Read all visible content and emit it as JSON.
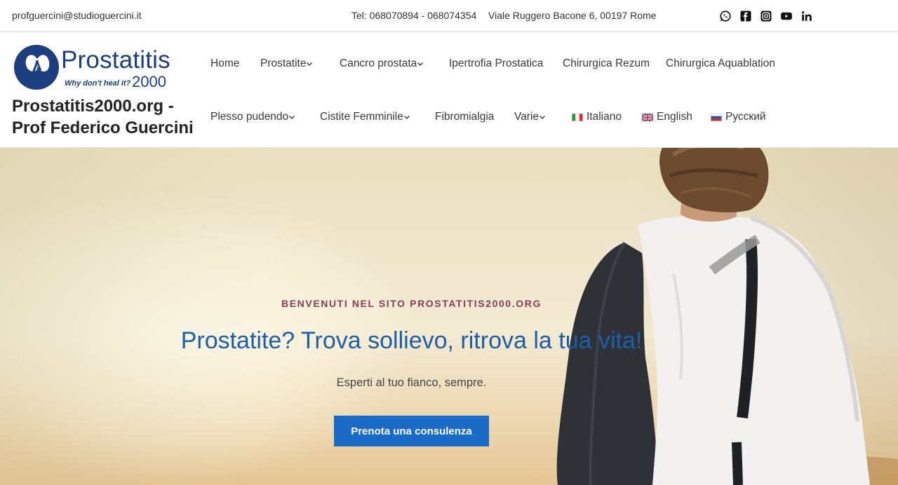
{
  "topbar": {
    "email": "profguercini@studioguercini.it",
    "phone": "Tel: 068070894 - 068074354",
    "address": "Viale Ruggero Bacone 6, 00197 Rome",
    "social": [
      "whatsapp-icon",
      "facebook-icon",
      "instagram-icon",
      "youtube-icon",
      "linkedin-icon"
    ]
  },
  "logo": {
    "brand": "Prostatitis",
    "tagline": "Why don't heal it?",
    "year": "2000"
  },
  "site_title_line1": "Prostatitis2000.org -",
  "site_title_line2": "Prof Federico Guercini",
  "nav": {
    "row1": [
      {
        "label": "Home",
        "active": true,
        "dropdown": false
      },
      {
        "label": "Prostatite",
        "dropdown": true
      },
      {
        "label": "Cancro prostata",
        "dropdown": true
      },
      {
        "label": "Ipertrofia Prostatica",
        "dropdown": false
      },
      {
        "label": "Chirurgica Rezum",
        "dropdown": false
      },
      {
        "label": "Chirurgica Aquablation",
        "dropdown": false
      }
    ],
    "row2": [
      {
        "label": "Plesso pudendo",
        "dropdown": true
      },
      {
        "label": "Cistite Femminile",
        "dropdown": true
      },
      {
        "label": "Fibromialgia",
        "dropdown": false
      },
      {
        "label": "Varie",
        "dropdown": true
      },
      {
        "label": "Italiano",
        "flag": "italy-flag-icon"
      },
      {
        "label": "English",
        "flag": "uk-flag-icon"
      },
      {
        "label": "Русский",
        "flag": "russia-flag-icon"
      }
    ]
  },
  "hero": {
    "eyebrow": "BENVENUTI NEL SITO PROSTATITIS2000.ORG",
    "headline": "Prostatite? Trova sollievo, ritrova la tua vita!",
    "subtitle": "Esperti al tuo fianco, sempre.",
    "cta_label": "Prenota una consulenza"
  },
  "colors": {
    "brand_blue": "#1d3e7e",
    "link_blue": "#1d5ea8",
    "button_blue": "#1a6bc7",
    "eyebrow": "#8a3b55"
  }
}
